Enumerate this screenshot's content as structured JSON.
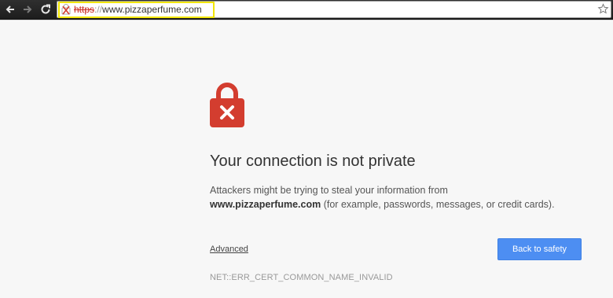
{
  "browser": {
    "url": {
      "scheme": "https",
      "separator": "://",
      "host": "www.pizzaperfume.com"
    },
    "icons": {
      "back": "back-arrow-icon",
      "forward": "forward-arrow-icon",
      "reload": "reload-icon",
      "security": "broken-lock-icon",
      "bookmark": "star-icon"
    }
  },
  "interstitial": {
    "icon": "red-lock-icon",
    "title": "Your connection is not private",
    "message_prefix": "Attackers might be trying to steal your information from",
    "message_domain": "www.pizzaperfume.com",
    "message_suffix": "(for example, passwords, messages, or credit cards).",
    "advanced_label": "Advanced",
    "back_button_label": "Back to safety",
    "error_code": "NET::ERR_CERT_COMMON_NAME_INVALID"
  },
  "colors": {
    "accent_blue": "#4d8ef2",
    "error_red": "#d33d2f",
    "highlight_yellow": "#f2e600",
    "background": "#f7f7f7"
  }
}
